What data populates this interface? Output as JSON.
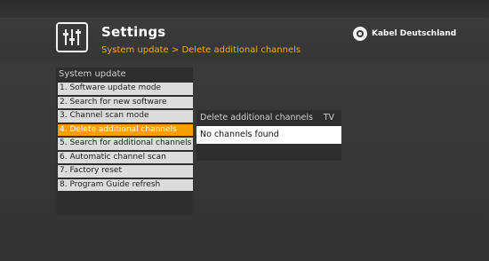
{
  "header": {
    "title": "Settings",
    "breadcrumb": "System update  >  Delete additional channels",
    "brand": "Kabel Deutschland",
    "app_icon": "equalizer-icon",
    "brand_icon": "kabel-deutschland-logo"
  },
  "menu": {
    "header": "System update",
    "items": [
      {
        "label": "1. Software update mode",
        "selected": false
      },
      {
        "label": "2. Search for new software",
        "selected": false
      },
      {
        "label": "3. Channel scan mode",
        "selected": false
      },
      {
        "label": "4. Delete additional channels",
        "selected": true
      },
      {
        "label": "5. Search for additional channels",
        "selected": false
      },
      {
        "label": "6. Automatic channel scan",
        "selected": false
      },
      {
        "label": "7. Factory reset",
        "selected": false
      },
      {
        "label": "8. Program Guide refresh",
        "selected": false
      }
    ]
  },
  "submenu": {
    "title": "Delete additional channels",
    "tag": "TV",
    "message": "No channels found"
  },
  "colors": {
    "accent": "#f5a000",
    "breadcrumb": "#f5a623",
    "background": "#333333",
    "item": "#dcdcdc"
  }
}
